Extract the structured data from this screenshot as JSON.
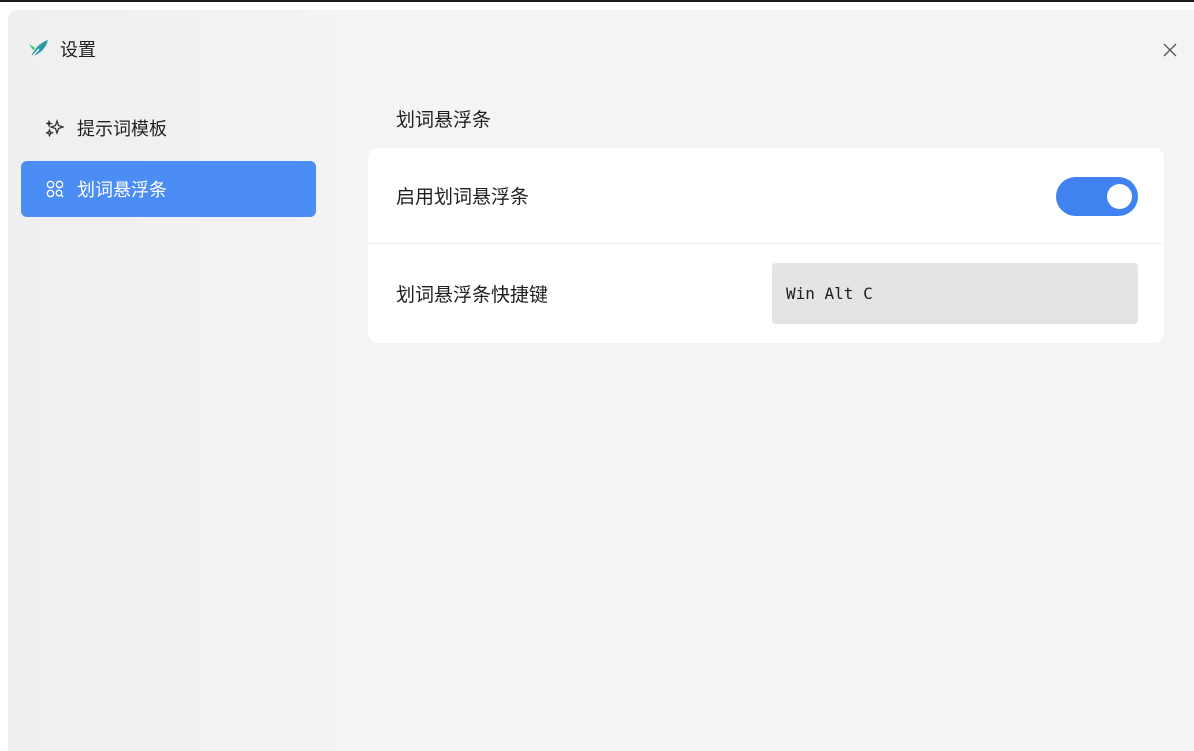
{
  "window": {
    "title": "设置",
    "app_icon": "feather-icon",
    "close_icon": "close-icon"
  },
  "sidebar": {
    "items": [
      {
        "label": "提示词模板",
        "icon": "sparkle-icon",
        "active": false
      },
      {
        "label": "划词悬浮条",
        "icon": "apps-grid-icon",
        "active": true
      }
    ]
  },
  "main": {
    "section_title": "划词悬浮条",
    "settings": {
      "enable_label": "启用划词悬浮条",
      "enable_value": true,
      "shortcut_label": "划词悬浮条快捷键",
      "shortcut_value": "Win Alt C"
    }
  },
  "colors": {
    "accent": "#4c8df5",
    "toggle_on": "#3f82f0",
    "window_bg": "#f4f4f5",
    "card_bg": "#ffffff",
    "field_bg": "#e4e4e5"
  }
}
